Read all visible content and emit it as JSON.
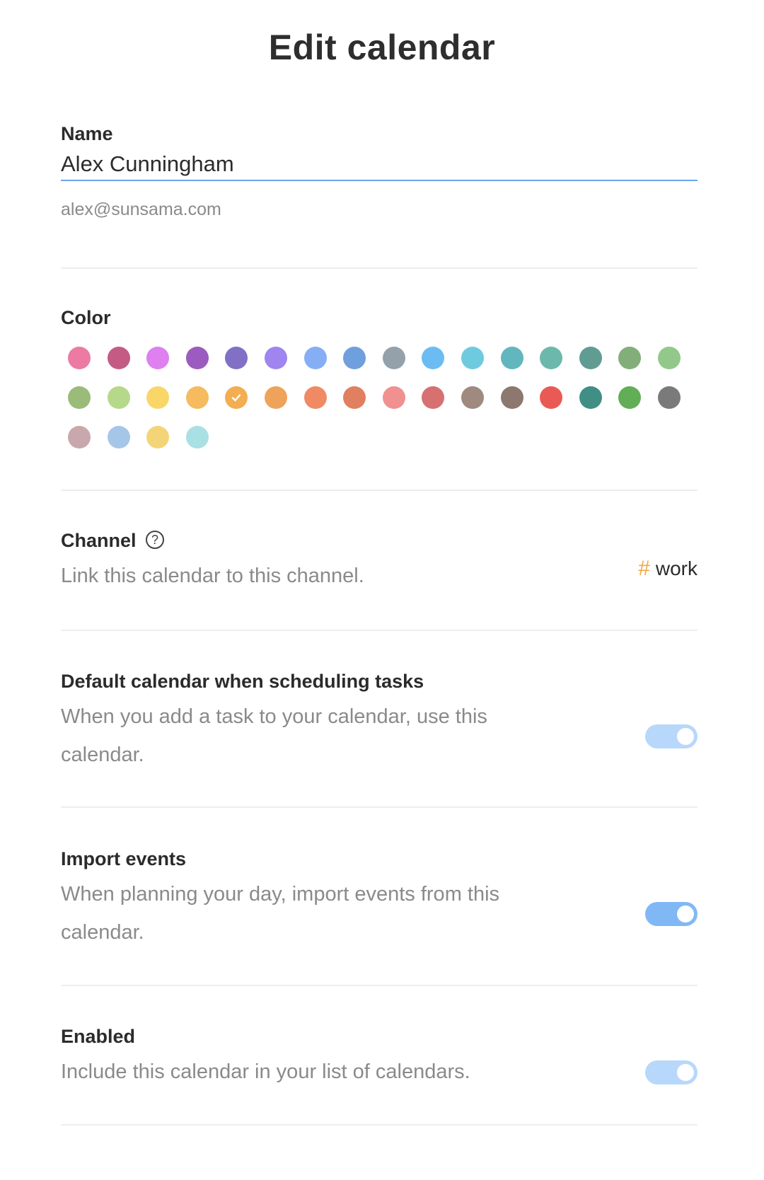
{
  "header": {
    "title": "Edit calendar"
  },
  "name_section": {
    "label": "Name",
    "value": "Alex Cunningham",
    "email": "alex@sunsama.com"
  },
  "color_section": {
    "label": "Color",
    "selected_index": 20,
    "colors": [
      "#ec7aa2",
      "#c45b85",
      "#de80f0",
      "#9b5bbf",
      "#8270c6",
      "#a084f0",
      "#86aef5",
      "#6f9fdd",
      "#94a1ab",
      "#6bbcf2",
      "#6ecbdf",
      "#62b6bd",
      "#6cb8ac",
      "#619c93",
      "#82ae7a",
      "#92c98a",
      "#9bbb7a",
      "#b5d88a",
      "#f8d768",
      "#f5bb5e",
      "#f2ae51",
      "#efa35a",
      "#f08a65",
      "#e08060",
      "#f09090",
      "#d77070",
      "#a08a80",
      "#8d7870",
      "#ea5a55",
      "#3f8f85",
      "#62ae56",
      "#7a7a7a",
      "#c8a8ac",
      "#a6c6e8",
      "#f3d578",
      "#a8e0e4"
    ]
  },
  "channel_section": {
    "label": "Channel",
    "help_icon": "question-circle-icon",
    "description": "Link this calendar to this channel.",
    "hash": "#",
    "channel": "work",
    "hash_color": "#f2a946"
  },
  "default_section": {
    "label": "Default calendar when scheduling tasks",
    "description_line1": "When you add a task to your calendar, use this",
    "description_line2": "calendar.",
    "toggle_on": true,
    "toggle_color": "#b7d8fb"
  },
  "import_section": {
    "label": "Import events",
    "description_line1": "When planning your day, import events from this",
    "description_line2": "calendar.",
    "toggle_on": true,
    "toggle_color": "#80b8f6"
  },
  "enabled_section": {
    "label": "Enabled",
    "description": "Include this calendar in your list of calendars.",
    "toggle_on": true,
    "toggle_color": "#b7d8fb"
  }
}
